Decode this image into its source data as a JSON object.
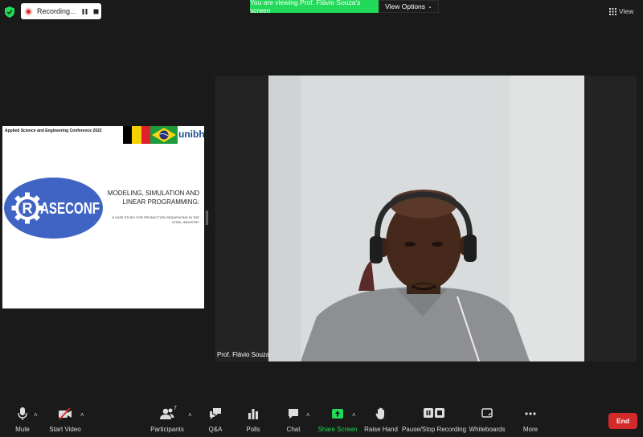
{
  "top_bar": {
    "recording_label": "Recording...",
    "banner_text": "You are viewing Prof. Flávio Souza's screen",
    "view_options_label": "View Options",
    "view_label": "View"
  },
  "shared_slide": {
    "conference_name": "Applied Science and Engineering Conference 2022",
    "university_logo_text": "unibh",
    "title": "MODELING, SIMULATION AND LINEAR PROGRAMMING:",
    "subtitle": "A CASE STUDY FOR PRODUCTION SEQUENCING IN THE STEEL INDUSTRY",
    "logo_text": "ASECONF",
    "logo_initial": "R"
  },
  "video": {
    "participant_name": "Prof. Flávio Souza"
  },
  "toolbar": {
    "mute_label": "Mute",
    "start_video_label": "Start Video",
    "participants_label": "Participants",
    "participants_count": "7",
    "qa_label": "Q&A",
    "polls_label": "Polls",
    "chat_label": "Chat",
    "share_screen_label": "Share Screen",
    "raise_hand_label": "Raise Hand",
    "pause_stop_recording_label": "Pause/Stop Recording",
    "whiteboards_label": "Whiteboards",
    "more_label": "More",
    "end_label": "End"
  },
  "colors": {
    "background": "#1a1a1a",
    "banner_green": "#23d959",
    "end_red": "#d32b2b",
    "logo_blue": "#3f64c4"
  }
}
